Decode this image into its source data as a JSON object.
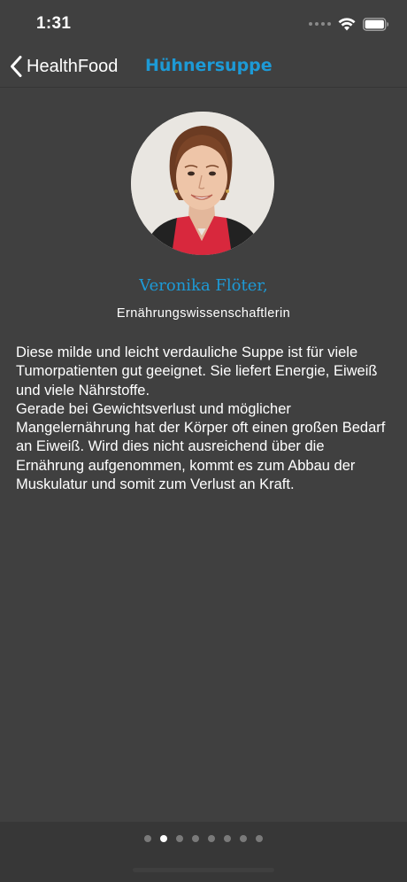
{
  "status_bar": {
    "time": "1:31",
    "icons": [
      "signal-dots-icon",
      "wifi-icon",
      "battery-icon"
    ]
  },
  "nav": {
    "back_label": "HealthFood",
    "back_icon": "chevron-left-icon",
    "title": "Hühnersuppe",
    "title_color": "#1d9ad6"
  },
  "author": {
    "name": "Veronika Flöter,",
    "role": "Ernährungswissenschaftlerin",
    "name_color": "#1d9ad6"
  },
  "content": {
    "paragraphs": [
      "Diese milde und leicht verdauliche Suppe ist für viele Tumorpatienten gut geeignet. Sie liefert Energie, Eiweiß und viele Nährstoffe.",
      "Gerade bei Gewichtsverlust und möglicher Mangelernährung hat der Körper oft einen großen Bedarf an Eiweiß. Wird dies nicht ausreichend über die Ernährung aufgenommen, kommt es zum Abbau der Muskulatur und somit zum Verlust an Kraft."
    ]
  },
  "pager": {
    "total": 8,
    "active_index": 1
  },
  "colors": {
    "background": "#404040",
    "accent": "#1d9ad6",
    "footer": "#373737"
  }
}
